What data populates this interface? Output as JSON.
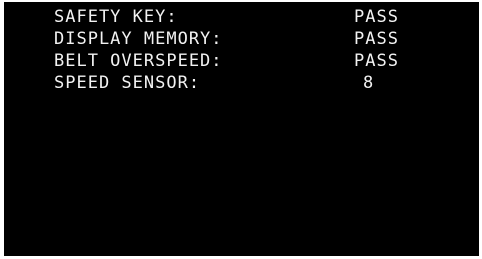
{
  "diagnostics": {
    "rows": [
      {
        "label": "SAFETY KEY:",
        "value": "PASS"
      },
      {
        "label": "DISPLAY MEMORY:",
        "value": "PASS"
      },
      {
        "label": "BELT OVERSPEED:",
        "value": "PASS"
      },
      {
        "label": "SPEED SENSOR:",
        "value": "8"
      }
    ]
  }
}
